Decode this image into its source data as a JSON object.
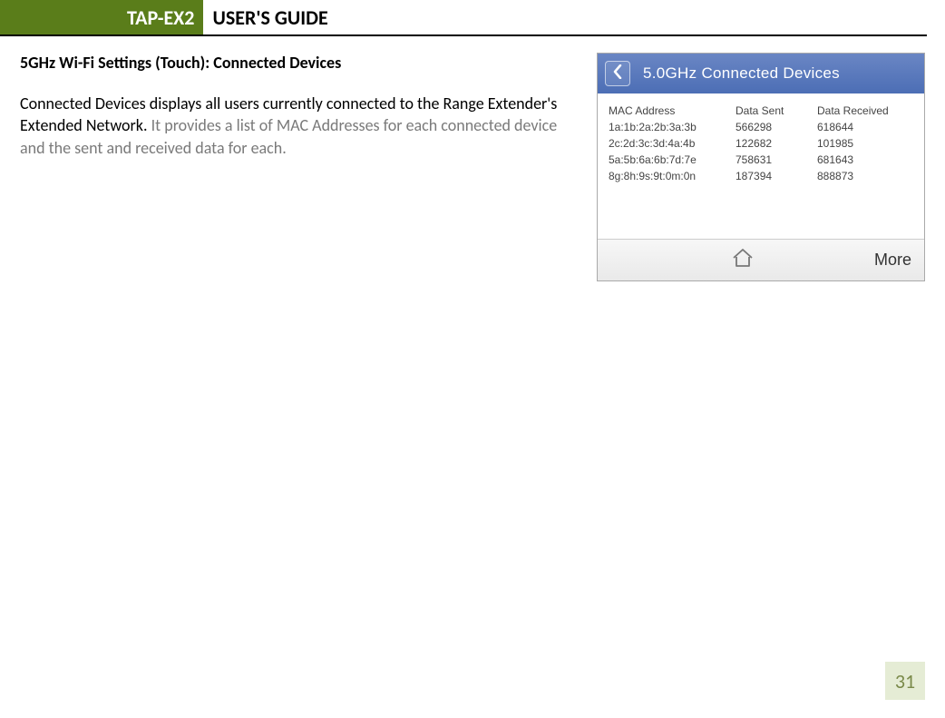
{
  "header": {
    "product": "TAP-EX2",
    "guide": "USER'S GUIDE"
  },
  "section_title": "5GHz Wi-Fi Settings (Touch): Connected Devices",
  "body": {
    "strong": "Connected Devices displays all users currently connected to the Range Extender's Extended Network. ",
    "grey": "It provides a list of MAC Addresses for each connected device and the sent and received data for each."
  },
  "device": {
    "title": "5.0GHz Connected Devices",
    "headers": {
      "mac": "MAC Address",
      "sent": "Data Sent",
      "recv": "Data Received"
    },
    "rows": [
      {
        "mac": "1a:1b:2a:2b:3a:3b",
        "sent": "566298",
        "recv": "618644"
      },
      {
        "mac": "2c:2d:3c:3d:4a:4b",
        "sent": "122682",
        "recv": "101985"
      },
      {
        "mac": "5a:5b:6a:6b:7d:7e",
        "sent": "758631",
        "recv": "681643"
      },
      {
        "mac": "8g:8h:9s:9t:0m:0n",
        "sent": "187394",
        "recv": "888873"
      }
    ],
    "more": "More"
  },
  "page_number": "31"
}
